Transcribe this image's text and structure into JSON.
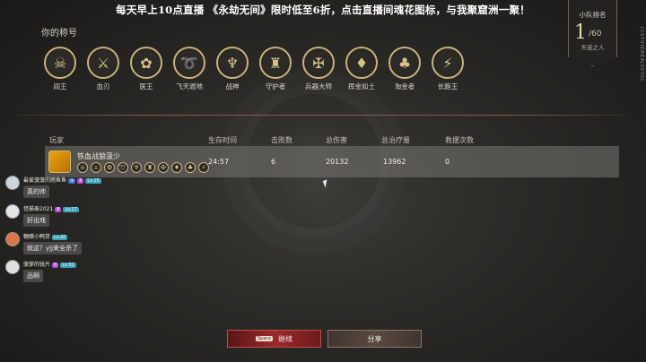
{
  "banner": "每天早上10点直播 《永劫无间》限时低至6折，点击直播间魂花图标，与我聚窟洲一聚！",
  "titles": {
    "label": "你的称号",
    "badges": [
      {
        "label": "阎王",
        "icon": "demon-mask-icon",
        "glyph": "☠"
      },
      {
        "label": "血刃",
        "icon": "blade-icon",
        "glyph": "⚔"
      },
      {
        "label": "医王",
        "icon": "lotus-icon",
        "glyph": "✿"
      },
      {
        "label": "飞天遁地",
        "icon": "hook-icon",
        "glyph": "➰"
      },
      {
        "label": "战神",
        "icon": "war-god-icon",
        "glyph": "♆"
      },
      {
        "label": "守护者",
        "icon": "guardian-icon",
        "glyph": "♜"
      },
      {
        "label": "兵器大师",
        "icon": "crossed-weapons-icon",
        "glyph": "✠"
      },
      {
        "label": "挥金如土",
        "icon": "gold-icon",
        "glyph": "♦"
      },
      {
        "label": "淘金者",
        "icon": "money-bag-icon",
        "glyph": "♣"
      },
      {
        "label": "长跑王",
        "icon": "boot-icon",
        "glyph": "⚡"
      }
    ]
  },
  "rank": {
    "title": "小队排名",
    "place": "1",
    "total": "/60",
    "subtitle": "天选之人"
  },
  "watermark": "[CSTV]DREA[0030]",
  "table": {
    "headers": [
      "玩家",
      "生存时间",
      "击败数",
      "总伤害",
      "总治疗量",
      "救援次数"
    ],
    "rows": [
      {
        "player": "铁血战狼菠少",
        "survival": "24:57",
        "kills": "6",
        "damage": "20132",
        "healing": "13962",
        "rescues": "0",
        "mini_badges": [
          "☠",
          "⚔",
          "✿",
          "➰",
          "♆",
          "♜",
          "✠",
          "♦",
          "♣",
          "⚡"
        ]
      }
    ]
  },
  "chat": [
    {
      "user": "最爱菠菠的雨鱼鱼",
      "tags": [
        "⊕",
        "8",
        "Lv.15"
      ],
      "message": "真的帅",
      "avatar_color": "#c9d6e0"
    },
    {
      "user": "怪猫泰2021",
      "tags": [
        "8",
        "Lv.17"
      ],
      "message": "好出戏",
      "avatar_color": "#e4e4e4"
    },
    {
      "user": "糖醋小鸭货",
      "tags": [
        "Lv.20"
      ],
      "message": "就这？yjj来全杀了",
      "avatar_color": "#d87848"
    },
    {
      "user": "菠萝的锐片",
      "tags": [
        "8",
        "Lv.32"
      ],
      "message": "品啊",
      "avatar_color": "#e0e0e0"
    }
  ],
  "buttons": {
    "continue_key": "Space",
    "continue_label": "继续",
    "share_label": "分享"
  },
  "colors": {
    "gold": "#c9b27a",
    "continue_red": "#9a2a2a",
    "share_brown": "#5a4a40"
  }
}
